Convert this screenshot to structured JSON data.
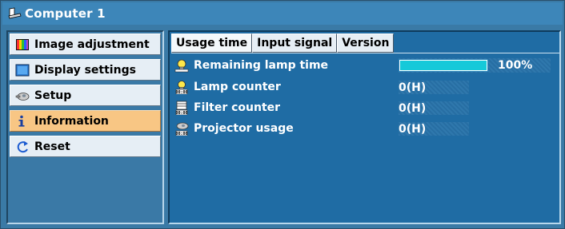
{
  "window": {
    "title": "Computer 1"
  },
  "sidebar": {
    "items": [
      {
        "label": "Image adjustment",
        "icon": "image-adjustment-icon"
      },
      {
        "label": "Display settings",
        "icon": "display-settings-icon"
      },
      {
        "label": "Setup",
        "icon": "setup-icon"
      },
      {
        "label": "Information",
        "icon": "information-icon",
        "active": true
      },
      {
        "label": "Reset",
        "icon": "reset-icon"
      }
    ]
  },
  "tabs": [
    {
      "label": "Usage time",
      "active": true
    },
    {
      "label": "Input signal"
    },
    {
      "label": "Version"
    }
  ],
  "usage": {
    "remaining_lamp_label": "Remaining lamp time",
    "remaining_lamp_percent": "100%",
    "remaining_lamp_fraction": 1.0,
    "lamp_counter_label": "Lamp counter",
    "lamp_counter_value": "0(H)",
    "filter_counter_label": "Filter counter",
    "filter_counter_value": "0(H)",
    "projector_usage_label": "Projector usage",
    "projector_usage_value": "0(H)"
  },
  "colors": {
    "panel": "#1f6ca4",
    "menu_active": "#f8c684",
    "lamp_bar": "#16c9d9"
  }
}
